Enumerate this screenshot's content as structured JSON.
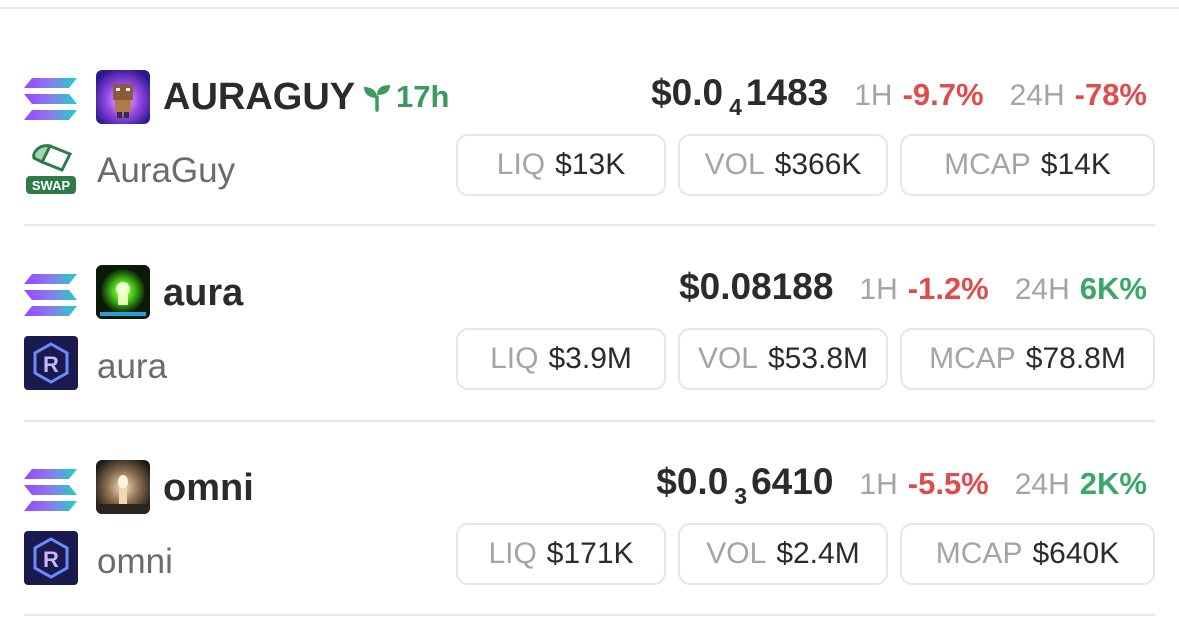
{
  "labels": {
    "h1": "1H",
    "h24": "24H",
    "liq": "LIQ",
    "vol": "VOL",
    "mcap": "MCAP"
  },
  "colors": {
    "negative": "#e04b4b",
    "positive": "#3aa66a",
    "age": "#3c9a5f"
  },
  "tokens": [
    {
      "symbol": "AURAGUY",
      "age": "17h",
      "name": "AuraGuy",
      "dex_icon": "swap-icon",
      "dex_text": "SWAP",
      "price_main": "$0.0",
      "price_zeros": "4",
      "price_digits": "1483",
      "change_1h": "-9.7%",
      "change_24h": "-78%",
      "liq": "$13K",
      "vol": "$366K",
      "mcap": "$14K"
    },
    {
      "symbol": "aura",
      "name": "aura",
      "dex_icon": "raydium-icon",
      "price_main": "$0.08188",
      "change_1h": "-1.2%",
      "change_24h": "6K%",
      "liq": "$3.9M",
      "vol": "$53.8M",
      "mcap": "$78.8M"
    },
    {
      "symbol": "omni",
      "name": "omni",
      "dex_icon": "raydium-icon",
      "price_main": "$0.0",
      "price_zeros": "3",
      "price_digits": "6410",
      "change_1h": "-5.5%",
      "change_24h": "2K%",
      "liq": "$171K",
      "vol": "$2.4M",
      "mcap": "$640K"
    }
  ]
}
